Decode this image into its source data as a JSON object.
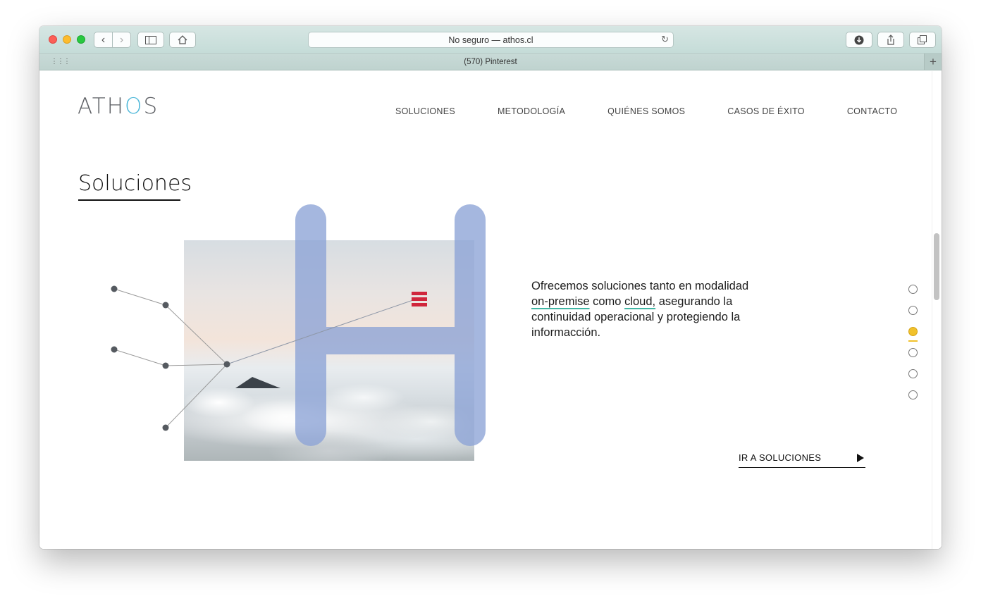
{
  "browser": {
    "url_text": "No seguro — athos.cl",
    "tab_title": "(570) Pinterest"
  },
  "site": {
    "logo_left": "ATH",
    "logo_o": "O",
    "logo_right": "S",
    "nav": [
      "SOLUCIONES",
      "METODOLOGÍA",
      "QUIÉNES SOMOS",
      "CASOS DE ÉXITO",
      "CONTACTO"
    ]
  },
  "section": {
    "title": "Soluciones",
    "text_1": "Ofrecemos soluciones tanto en modalidad ",
    "text_on_premise": "on-premise",
    "text_2": " como ",
    "text_cloud": "cloud,",
    "text_3": " asegurando la continuidad operacional y protegiendo la informacción.",
    "cta_label": "IR A SOLUCIONES"
  },
  "slider": {
    "count": 6,
    "active_index": 2
  },
  "colors": {
    "accent_yellow": "#f1c12c",
    "underline_teal": "#42b7a5",
    "h_blue": "#8ca3d6",
    "logo_blue": "#4fb8d9",
    "red_mark": "#d0263c"
  }
}
